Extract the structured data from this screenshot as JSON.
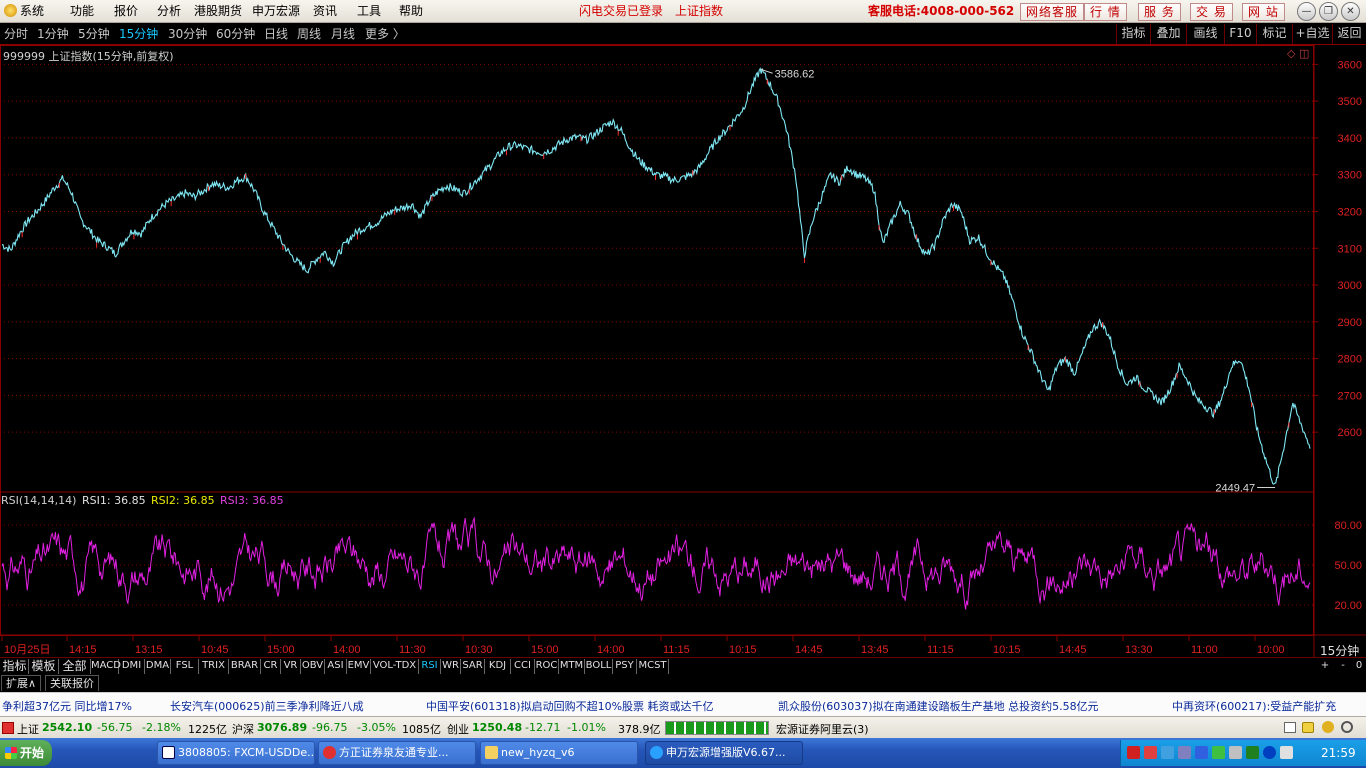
{
  "menu": [
    "系统",
    "功能",
    "报价",
    "分析",
    "港股期货",
    "申万宏源",
    "资讯",
    "工具",
    "帮助"
  ],
  "notice": {
    "login": "闪电交易已登录",
    "index": "上证指数"
  },
  "hotline": "客服电话:4008-000-562",
  "top_buttons": [
    "网络客服",
    "行 情",
    "服 务",
    "交 易",
    "网 站"
  ],
  "periods": [
    "分时",
    "1分钟",
    "5分钟",
    "15分钟",
    "30分钟",
    "60分钟",
    "日线",
    "周线",
    "月线",
    "更多 〉"
  ],
  "active_period": "15分钟",
  "tools": [
    "指标",
    "叠加",
    "画线",
    "F10",
    "标记",
    "+自选",
    "返回"
  ],
  "main": {
    "title": "999999 上证指数(15分钟,前复权)",
    "high_label": "3586.62",
    "low_label": "2449.47"
  },
  "price_axis": [
    "3600",
    "3500",
    "3400",
    "3300",
    "3200",
    "3100",
    "3000",
    "2900",
    "2800",
    "2700",
    "2600"
  ],
  "rsi": {
    "title": "RSI(14,14,14)",
    "rsi1": "RSI1: 36.85",
    "rsi2": "RSI2: 36.85",
    "rsi3": "RSI3: 36.85",
    "axis": [
      "80.00",
      "50.00",
      "20.00"
    ]
  },
  "time_axis": [
    "10月25日",
    "14:15",
    "13:15",
    "10:45",
    "15:00",
    "14:00",
    "11:30",
    "10:30",
    "15:00",
    "14:00",
    "11:15",
    "10:15",
    "14:45",
    "13:45",
    "11:15",
    "10:15",
    "14:45",
    "13:30",
    "11:00",
    "10:00"
  ],
  "period_label": "15分钟",
  "indicators": [
    "指标",
    "模板",
    "全部",
    "MACD",
    "DMI",
    "DMA",
    "FSL",
    "TRIX",
    "BRAR",
    "CR",
    "VR",
    "OBV",
    "ASI",
    "EMV",
    "VOL-TDX",
    "RSI",
    "WR",
    "SAR",
    "KDJ",
    "CCI",
    "ROC",
    "MTM",
    "BOLL",
    "PSY",
    "MCST"
  ],
  "active_indicator": "RSI",
  "right_ctrls": [
    "+",
    "-",
    "0"
  ],
  "ext_tabs": [
    "扩展∧",
    "关联报价"
  ],
  "news": [
    "争利超37亿元 同比增17%",
    "长安汽车(000625)前三季净利降近八成",
    "中国平安(601318)拟启动回购不超10%股票 耗资或达千亿",
    "凯众股份(603037)拟在南通建设踏板生产基地 总投资约5.58亿元",
    "中再资环(600217):受益产能扩充"
  ],
  "status": {
    "sh_name": "上证",
    "sh_val": "2542.10",
    "sh_chg": "-56.75",
    "sh_pct": "-2.18%",
    "sh_amt": "1225亿",
    "sz_name": "沪深",
    "sz_val": "3076.89",
    "sz_chg": "-96.75",
    "sz_pct": "-3.05%",
    "sz_amt": "1085亿",
    "cy_name": "创业",
    "cy_val": "1250.48",
    "cy_chg": "-12.71",
    "cy_pct": "-1.01%",
    "cy_amt": "378.9亿",
    "server": "宏源证券阿里云(3)"
  },
  "taskbar": {
    "start": "开始",
    "tasks": [
      "3808805: FXCM-USDDe...",
      "方正证券泉友通专业...",
      "new_hyzq_v6",
      "申万宏源增强版V6.67..."
    ],
    "clock": "21:59"
  },
  "colors": {
    "price_line": "#7fe8f4",
    "rsi_line": "#e020e0",
    "grid": "#8a0000",
    "axis_text": "#e02020",
    "active": "#19c8ff"
  },
  "chart_data": {
    "type": "line",
    "series": [
      {
        "name": "上证指数",
        "values": [
          3110,
          3095,
          3140,
          3175,
          3200,
          3230,
          3265,
          3290,
          3250,
          3180,
          3150,
          3120,
          3105,
          3085,
          3120,
          3150,
          3140,
          3180,
          3205,
          3225,
          3235,
          3250,
          3240,
          3255,
          3275,
          3270,
          3265,
          3285,
          3295,
          3255,
          3200,
          3160,
          3120,
          3085,
          3060,
          3040,
          3070,
          3090,
          3060,
          3100,
          3130,
          3150,
          3160,
          3170,
          3190,
          3205,
          3210,
          3220,
          3185,
          3230,
          3255,
          3270,
          3260,
          3250,
          3275,
          3300,
          3325,
          3355,
          3375,
          3380,
          3372,
          3365,
          3360,
          3368,
          3385,
          3398,
          3402,
          3395,
          3410,
          3430,
          3445,
          3420,
          3375,
          3340,
          3320,
          3300,
          3295,
          3285,
          3290,
          3300,
          3320,
          3360,
          3395,
          3420,
          3450,
          3480,
          3540,
          3586.62,
          3550,
          3500,
          3420,
          3300,
          3080,
          3180,
          3240,
          3300,
          3280,
          3320,
          3300,
          3290,
          3260,
          3110,
          3170,
          3220,
          3190,
          3120,
          3080,
          3110,
          3180,
          3220,
          3200,
          3120,
          3130,
          3085,
          3050,
          3020,
          2950,
          2870,
          2820,
          2760,
          2710,
          2780,
          2800,
          2760,
          2820,
          2880,
          2900,
          2860,
          2780,
          2730,
          2750,
          2720,
          2700,
          2680,
          2720,
          2780,
          2740,
          2690,
          2670,
          2650,
          2700,
          2780,
          2800,
          2720,
          2600,
          2520,
          2449.47,
          2560,
          2680,
          2620,
          2560
        ]
      }
    ],
    "ylim": [
      2440,
      3620
    ],
    "grid": true,
    "y_ticks": [
      3600,
      3500,
      3400,
      3300,
      3200,
      3100,
      3000,
      2900,
      2800,
      2700,
      2600
    ],
    "high": 3586.62,
    "low": 2449.47,
    "sub_chart": {
      "name": "RSI",
      "ylim": [
        5,
        95
      ],
      "y_ticks": [
        80,
        50,
        20
      ],
      "last": 36.85
    }
  }
}
